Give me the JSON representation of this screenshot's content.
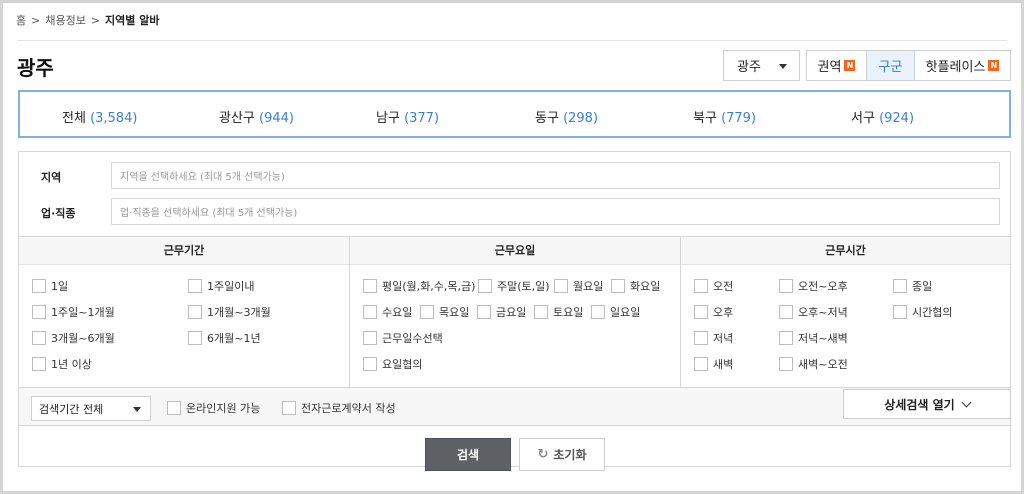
{
  "breadcrumb": {
    "home": "홈",
    "sep1": ">",
    "section": "채용정보",
    "sep2": ">",
    "current": "지역별 알바"
  },
  "page_title": "광주",
  "city_select": {
    "value": "광주"
  },
  "view_tabs": [
    {
      "label": "권역",
      "badge": "N"
    },
    {
      "label": "구군",
      "badge": ""
    },
    {
      "label": "핫플레이스",
      "badge": "N"
    }
  ],
  "regions": [
    {
      "name": "전체",
      "count": "(3,584)"
    },
    {
      "name": "광산구",
      "count": "(944)"
    },
    {
      "name": "남구",
      "count": "(377)"
    },
    {
      "name": "동구",
      "count": "(298)"
    },
    {
      "name": "북구",
      "count": "(779)"
    },
    {
      "name": "서구",
      "count": "(924)"
    }
  ],
  "fields": {
    "region": {
      "label": "지역",
      "placeholder": "지역을 선택하세요 (최대 5개 선택가능)"
    },
    "job": {
      "label": "업·직종",
      "placeholder": "업·직종을 선택하세요 (최대 5개 선택가능)"
    }
  },
  "period": {
    "header": "근무기간",
    "options": [
      "1일",
      "1주일이내",
      "1주일~1개월",
      "1개월~3개월",
      "3개월~6개월",
      "6개월~1년",
      "1년 이상"
    ]
  },
  "days": {
    "header": "근무요일",
    "options": [
      "평일(월,화,수,목,금)",
      "주말(토,일)",
      "월요일",
      "화요일",
      "수요일",
      "목요일",
      "금요일",
      "토요일",
      "일요일",
      "근무일수선택",
      "요일협의"
    ]
  },
  "time": {
    "header": "근무시간",
    "options": [
      "오전",
      "오전~오후",
      "종일",
      "오후",
      "오후~저녁",
      "시간협의",
      "저녁",
      "저녁~새벽",
      "새벽",
      "새벽~오전"
    ]
  },
  "bottom": {
    "search_period": "검색기간 전체",
    "online": "온라인지원 가능",
    "contract": "전자근로계약서 작성",
    "detail_button": "상세검색 열기"
  },
  "buttons": {
    "search": "검색",
    "reset": "초기화"
  }
}
